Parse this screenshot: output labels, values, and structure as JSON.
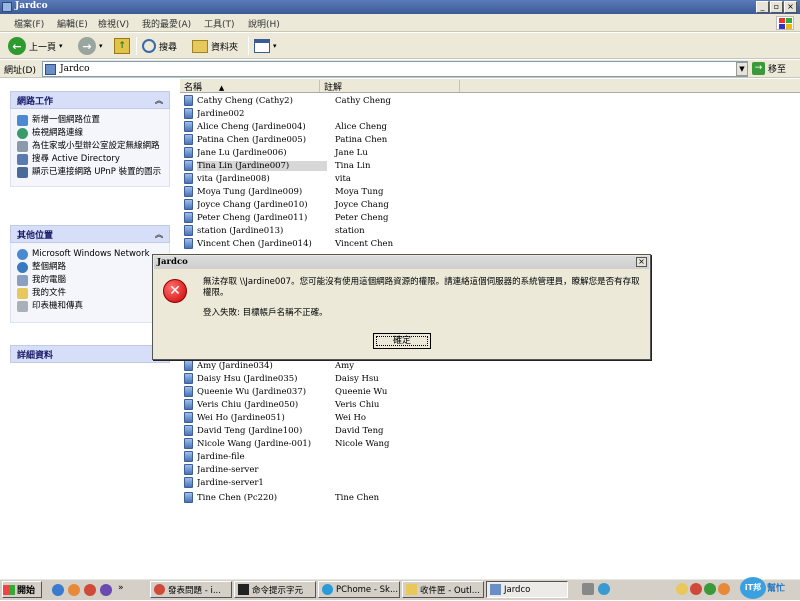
{
  "window": {
    "title": "Jardco"
  },
  "menu": [
    "檔案(F)",
    "編輯(E)",
    "檢視(V)",
    "我的最愛(A)",
    "工具(T)",
    "說明(H)"
  ],
  "toolbar": {
    "back": "上一頁",
    "search": "搜尋",
    "folders": "資料夾"
  },
  "address": {
    "label": "網址(D)",
    "value": "Jardco",
    "go": "移至"
  },
  "panels": {
    "network_tasks": {
      "title": "網路工作",
      "items": [
        "新增一個網路位置",
        "檢視網路連線",
        "為住家或小型辦公室設定無線網路",
        "搜尋 Active Directory",
        "顯示已連接網路 UPnP 裝置的圖示"
      ]
    },
    "other_places": {
      "title": "其他位置",
      "items": [
        "Microsoft Windows Network",
        "整個網路",
        "我的電腦",
        "我的文件",
        "印表機和傳真"
      ]
    },
    "details": {
      "title": "詳細資料"
    }
  },
  "list": {
    "columns": {
      "name": "名稱",
      "comment": "註解"
    },
    "rows": [
      {
        "name": "Cathy Cheng (Cathy2)",
        "comment": "Cathy Cheng"
      },
      {
        "name": "Jardine002",
        "comment": ""
      },
      {
        "name": "Alice Cheng (Jardine004)",
        "comment": "Alice Cheng"
      },
      {
        "name": "Patina Chen (Jardine005)",
        "comment": "Patina Chen"
      },
      {
        "name": "Jane Lu (Jardine006)",
        "comment": "Jane Lu"
      },
      {
        "name": "Tina Lin (Jardine007)",
        "comment": "Tina Lin"
      },
      {
        "name": "vita (Jardine008)",
        "comment": "vita"
      },
      {
        "name": "Moya Tung (Jardine009)",
        "comment": "Moya Tung"
      },
      {
        "name": "Joyce Chang (Jardine010)",
        "comment": "Joyce Chang"
      },
      {
        "name": "Peter Cheng (Jardine011)",
        "comment": "Peter Cheng"
      },
      {
        "name": "station (Jardine013)",
        "comment": "station"
      },
      {
        "name": "Vincent Chen (Jardine014)",
        "comment": "Vincent Chen"
      },
      {
        "name": "Amy (Jardine034)",
        "comment": "Amy"
      },
      {
        "name": "Daisy Hsu (Jardine035)",
        "comment": "Daisy Hsu"
      },
      {
        "name": "Queenie Wu (Jardine037)",
        "comment": "Queenie Wu"
      },
      {
        "name": "Veris Chiu (Jardine050)",
        "comment": "Veris Chiu"
      },
      {
        "name": "Wei Ho (Jardine051)",
        "comment": "Wei Ho"
      },
      {
        "name": "David Teng (Jardine100)",
        "comment": "David Teng"
      },
      {
        "name": "Nicole Wang (Jardine-001)",
        "comment": "Nicole Wang"
      },
      {
        "name": "Jardine-file",
        "comment": ""
      },
      {
        "name": "Jardine-server",
        "comment": ""
      },
      {
        "name": "Jardine-server1",
        "comment": ""
      },
      {
        "name": "Tine Chen (Pc220)",
        "comment": "Tine Chen"
      }
    ]
  },
  "dialog": {
    "title": "Jardco",
    "message": "無法存取 \\\\Jardine007。您可能沒有使用這個網路資源的權限。請連絡這個伺服器的系統管理員，瞭解您是否有存取權限。",
    "detail": "登入失敗: 目標帳戶名稱不正確。",
    "ok": "確定"
  },
  "taskbar": {
    "start": "開始",
    "tasks": [
      "發表問題 - i...",
      "命令提示字元",
      "PChome - Sk...",
      "收件匣 - Outl...",
      "Jardco"
    ],
    "brand": "幫忙"
  }
}
